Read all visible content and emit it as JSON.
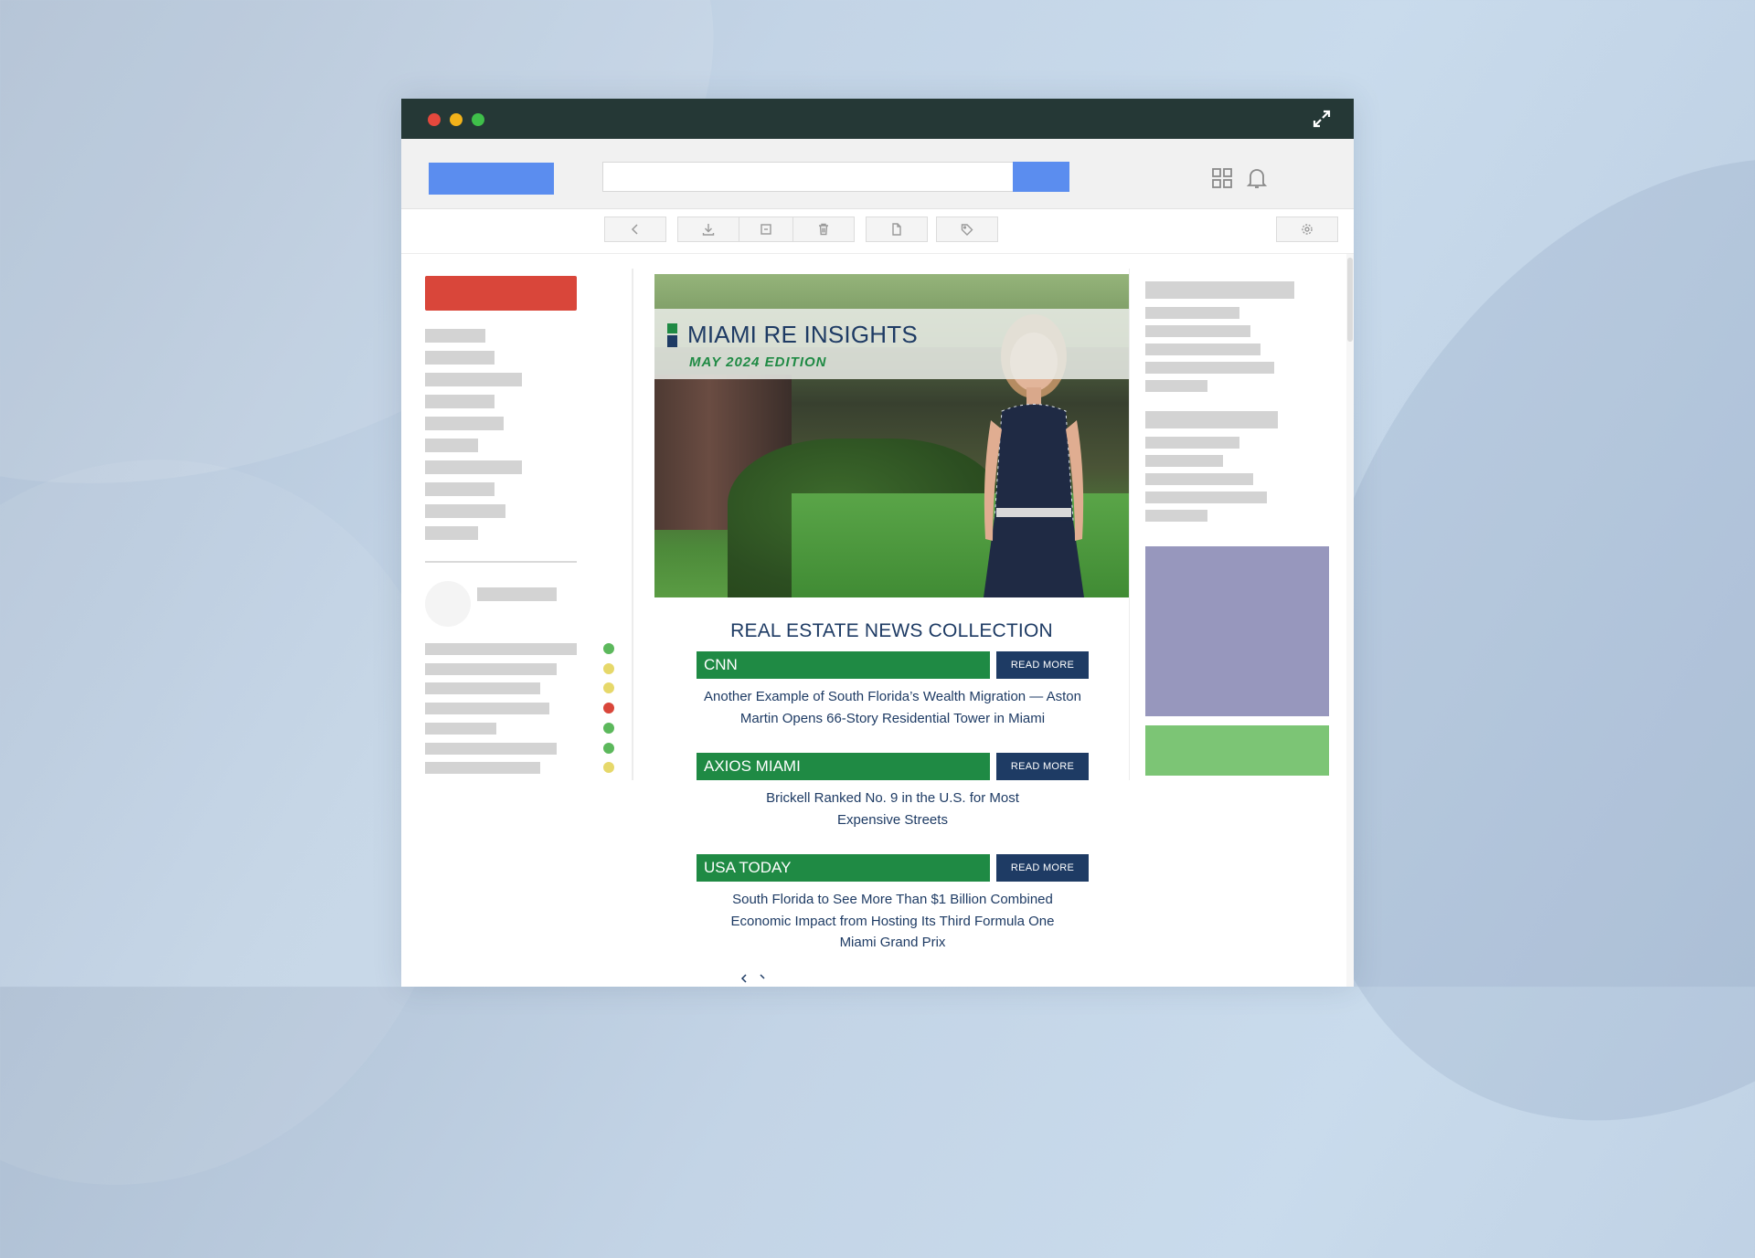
{
  "window": {
    "title_dots": [
      "close",
      "minimize",
      "maximize"
    ]
  },
  "icons": {
    "expand": "expand-icon",
    "apps": "apps-grid-icon",
    "notifications": "bell-icon",
    "back": "chevron-left-icon",
    "download": "download-icon",
    "archive": "archive-icon",
    "delete": "trash-icon",
    "file": "file-icon",
    "label": "tag-icon",
    "settings": "gear-icon"
  },
  "colors": {
    "titlebar": "#253836",
    "accent_blue": "#5b8def",
    "compose_red": "#d9463a",
    "brand_green": "#1f8a44",
    "brand_navy": "#1e3b64",
    "ad_purple": "#9797bd",
    "ad_green": "#7cc575"
  },
  "sidebar": {
    "status_dots": [
      "#5cb85c",
      "#e6d86a",
      "#e6d86a",
      "#d9463a",
      "#5cb85c",
      "#5cb85c",
      "#e6d86a"
    ]
  },
  "newsletter": {
    "title": "MIAMI RE INSIGHTS",
    "edition": "MAY 2024 EDITION",
    "heading": "REAL ESTATE NEWS COLLECTION",
    "read_more_label": "READ MORE",
    "items": [
      {
        "source": "CNN",
        "description": "Another Example of South Florida’s Wealth Migration — Aston Martin Opens 66-Story Residential Tower in Miami"
      },
      {
        "source": "AXIOS MIAMI",
        "description": "Brickell Ranked No. 9 in the U.S. for Most Expensive Streets"
      },
      {
        "source": "USA TODAY",
        "description": "South Florida to See More Than $1 Billion Combined Economic Impact from Hosting Its Third Formula One Miami Grand Prix"
      }
    ]
  }
}
